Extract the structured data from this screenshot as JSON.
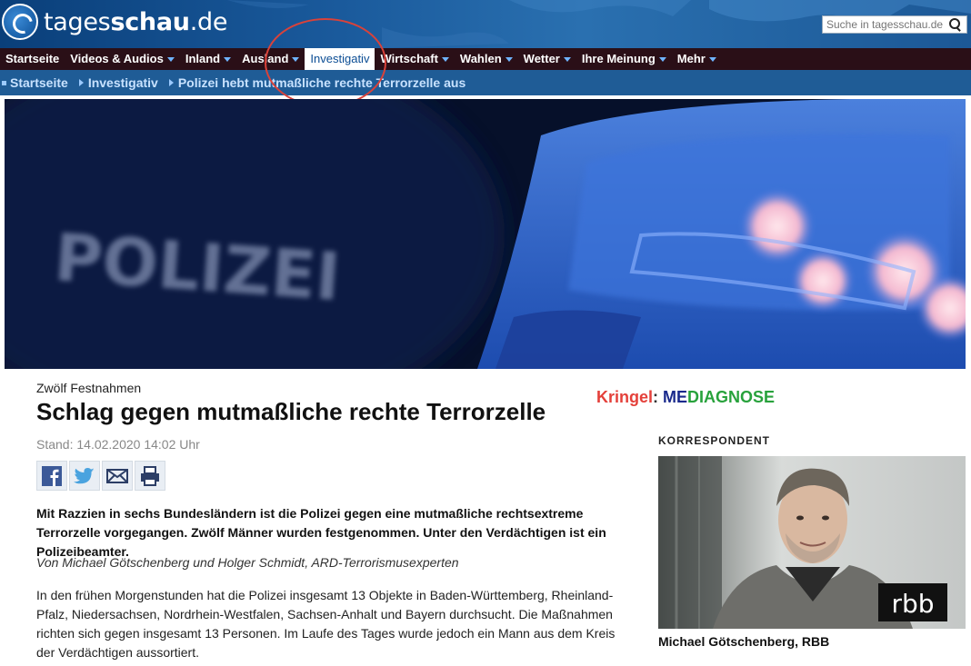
{
  "site": {
    "logo_text_regular": "tages",
    "logo_text_bold": "schau",
    "logo_text_tld": ".de",
    "search_placeholder": "Suche in tagesschau.de"
  },
  "nav": {
    "items": [
      {
        "label": "Startseite",
        "caret": false,
        "active": false
      },
      {
        "label": "Videos & Audios",
        "caret": true,
        "active": false
      },
      {
        "label": "Inland",
        "caret": true,
        "active": false
      },
      {
        "label": "Ausland",
        "caret": true,
        "active": false
      },
      {
        "label": "Investigativ",
        "caret": false,
        "active": true
      },
      {
        "label": "Wirtschaft",
        "caret": true,
        "active": false
      },
      {
        "label": "Wahlen",
        "caret": true,
        "active": false
      },
      {
        "label": "Wetter",
        "caret": true,
        "active": false
      },
      {
        "label": "Ihre Meinung",
        "caret": true,
        "active": false
      },
      {
        "label": "Mehr",
        "caret": true,
        "active": false
      }
    ]
  },
  "breadcrumb": {
    "items": [
      "Startseite",
      "Investigativ",
      "Polizei hebt mutmaßliche rechte Terrorzelle aus"
    ]
  },
  "hero": {
    "sign_text": "POLIZEI"
  },
  "article": {
    "kicker": "Zwölf Festnahmen",
    "headline": "Schlag gegen mutmaßliche rechte Terrorzelle",
    "date": "Stand: 14.02.2020 14:02 Uhr",
    "intro": "Mit Razzien in sechs Bundesländern ist die Polizei gegen eine mutmaßliche rechtsextreme Terrorzelle vorgegangen. Zwölf Männer wurden festgenommen. Unter den Verdächtigen ist ein Polizeibeamter.",
    "byline": "Von Michael Götschenberg und Holger Schmidt, ARD-Terrorismusexperten",
    "body": "In den frühen Morgenstunden hat die Polizei insgesamt 13 Objekte in Baden-Württemberg, Rheinland-Pfalz, Niedersachsen, Nordrhein-Westfalen, Sachsen-Anhalt und Bayern durchsucht. Die Maßnahmen richten sich gegen insgesamt 13 Personen. Im Laufe des Tages wurde jedoch ein Mann aus dem Kreis der Verdächtigen aussortiert."
  },
  "annotation": {
    "kringel_label": "Kringel",
    "colon": ": ",
    "brand_blue": "ME",
    "brand_green": "DIAGNOSE"
  },
  "sidebar": {
    "section_label": "KORRESPONDENT",
    "caption": "Michael Götschenberg, RBB",
    "station_logo": "rbb"
  },
  "colors": {
    "nav_bg": "#2a0f17",
    "breadcrumb_bg": "#1f5c96",
    "annotation_red": "#d9423a",
    "brand_blue": "#1a2a8c",
    "brand_green": "#28a23c"
  }
}
